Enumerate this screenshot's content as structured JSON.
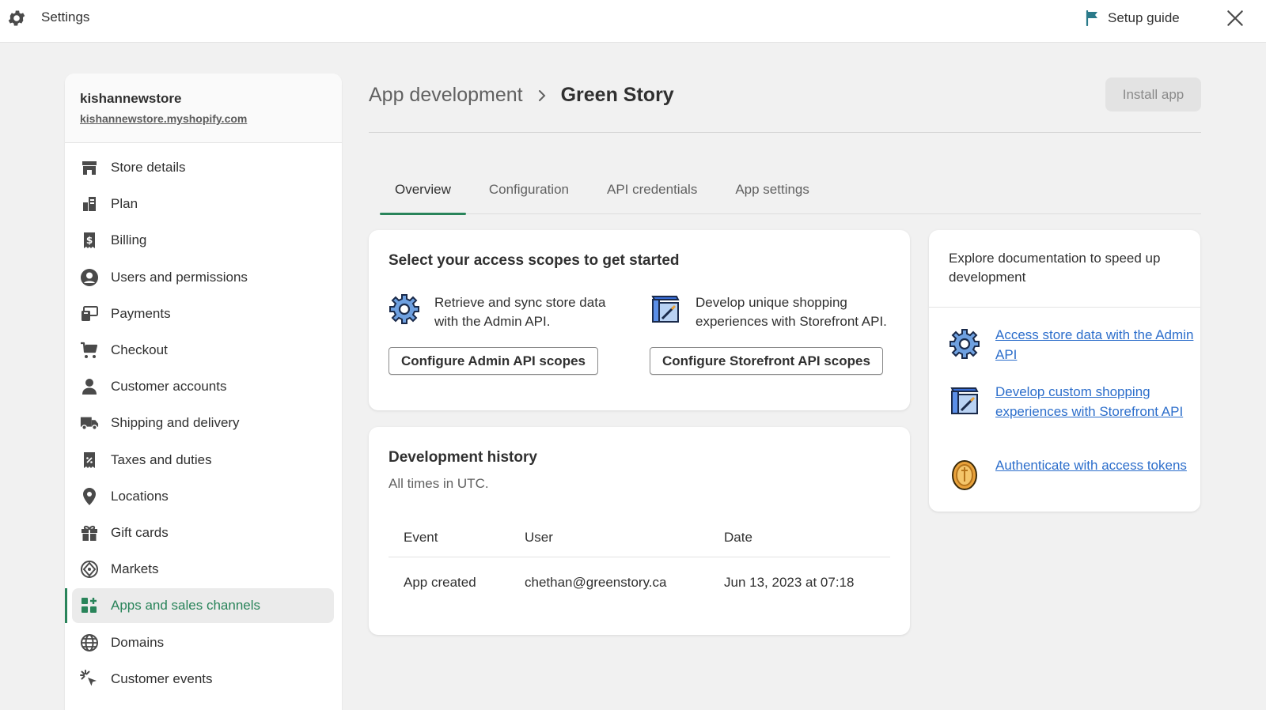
{
  "topbar": {
    "title": "Settings",
    "setup_guide": "Setup guide"
  },
  "store": {
    "name": "kishannewstore",
    "url": "kishannewstore.myshopify.com"
  },
  "sidebar": {
    "items": [
      {
        "label": "Store details",
        "icon": "store-icon"
      },
      {
        "label": "Plan",
        "icon": "plan-icon"
      },
      {
        "label": "Billing",
        "icon": "billing-icon"
      },
      {
        "label": "Users and permissions",
        "icon": "user-circle-icon"
      },
      {
        "label": "Payments",
        "icon": "payments-icon"
      },
      {
        "label": "Checkout",
        "icon": "cart-icon"
      },
      {
        "label": "Customer accounts",
        "icon": "person-icon"
      },
      {
        "label": "Shipping and delivery",
        "icon": "truck-icon"
      },
      {
        "label": "Taxes and duties",
        "icon": "tax-icon"
      },
      {
        "label": "Locations",
        "icon": "location-pin-icon"
      },
      {
        "label": "Gift cards",
        "icon": "gift-icon"
      },
      {
        "label": "Markets",
        "icon": "markets-icon"
      },
      {
        "label": "Apps and sales channels",
        "icon": "apps-icon",
        "active": true
      },
      {
        "label": "Domains",
        "icon": "globe-icon"
      },
      {
        "label": "Customer events",
        "icon": "cursor-click-icon"
      }
    ],
    "accent_color": "#29845a"
  },
  "header": {
    "breadcrumb_parent": "App development",
    "breadcrumb_current": "Green Story",
    "install_button": "Install app"
  },
  "tabs": [
    {
      "label": "Overview",
      "active": true
    },
    {
      "label": "Configuration"
    },
    {
      "label": "API credentials"
    },
    {
      "label": "App settings"
    }
  ],
  "scopes_card": {
    "title": "Select your access scopes to get started",
    "admin": {
      "text": "Retrieve and sync store data with the Admin API.",
      "button": "Configure Admin API scopes"
    },
    "storefront": {
      "text": "Develop unique shopping experiences with Storefront API.",
      "button": "Configure Storefront API scopes"
    }
  },
  "history_card": {
    "title": "Development history",
    "subtitle": "All times in UTC.",
    "columns": [
      "Event",
      "User",
      "Date"
    ],
    "rows": [
      {
        "event": "App created",
        "user": "chethan@greenstory.ca",
        "date": "Jun 13, 2023 at 07:18"
      }
    ]
  },
  "docs_card": {
    "heading": "Explore documentation to speed up development",
    "links": [
      {
        "label": "Access store data with the Admin API",
        "icon": "gear-pixel-icon"
      },
      {
        "label": "Develop custom shopping experiences with Storefront API",
        "icon": "storefront-pixel-icon"
      },
      {
        "label": "Authenticate with access tokens",
        "icon": "token-coin-icon"
      }
    ],
    "link_color": "#2c6ecb"
  }
}
